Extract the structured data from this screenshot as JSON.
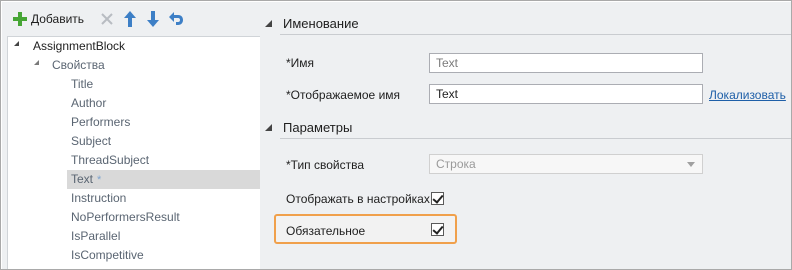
{
  "toolbar": {
    "add_label": "Добавить",
    "accent_add": "#46a535",
    "accent_arrows": "#3d7fc6"
  },
  "tree": {
    "root": "AssignmentBlock",
    "group": "Свойства",
    "items": [
      "Title",
      "Author",
      "Performers",
      "Subject",
      "ThreadSubject",
      "Text",
      "Instruction",
      "NoPerformersResult",
      "IsParallel",
      "IsCompetitive"
    ],
    "selected_index": 5,
    "selected_marker": "*"
  },
  "naming": {
    "title": "Именование",
    "name_label": "*Имя",
    "name_value": "Text",
    "display_name_label": "*Отображаемое имя",
    "display_name_value": "Text",
    "localize_link": "Локализовать"
  },
  "params": {
    "title": "Параметры",
    "type_label": "*Тип свойства",
    "type_value": "Строка",
    "show_in_settings_label": "Отображать в настройках",
    "show_in_settings_checked": true,
    "required_label": "Обязательное",
    "required_checked": true,
    "highlight_color": "#f0a04b"
  }
}
